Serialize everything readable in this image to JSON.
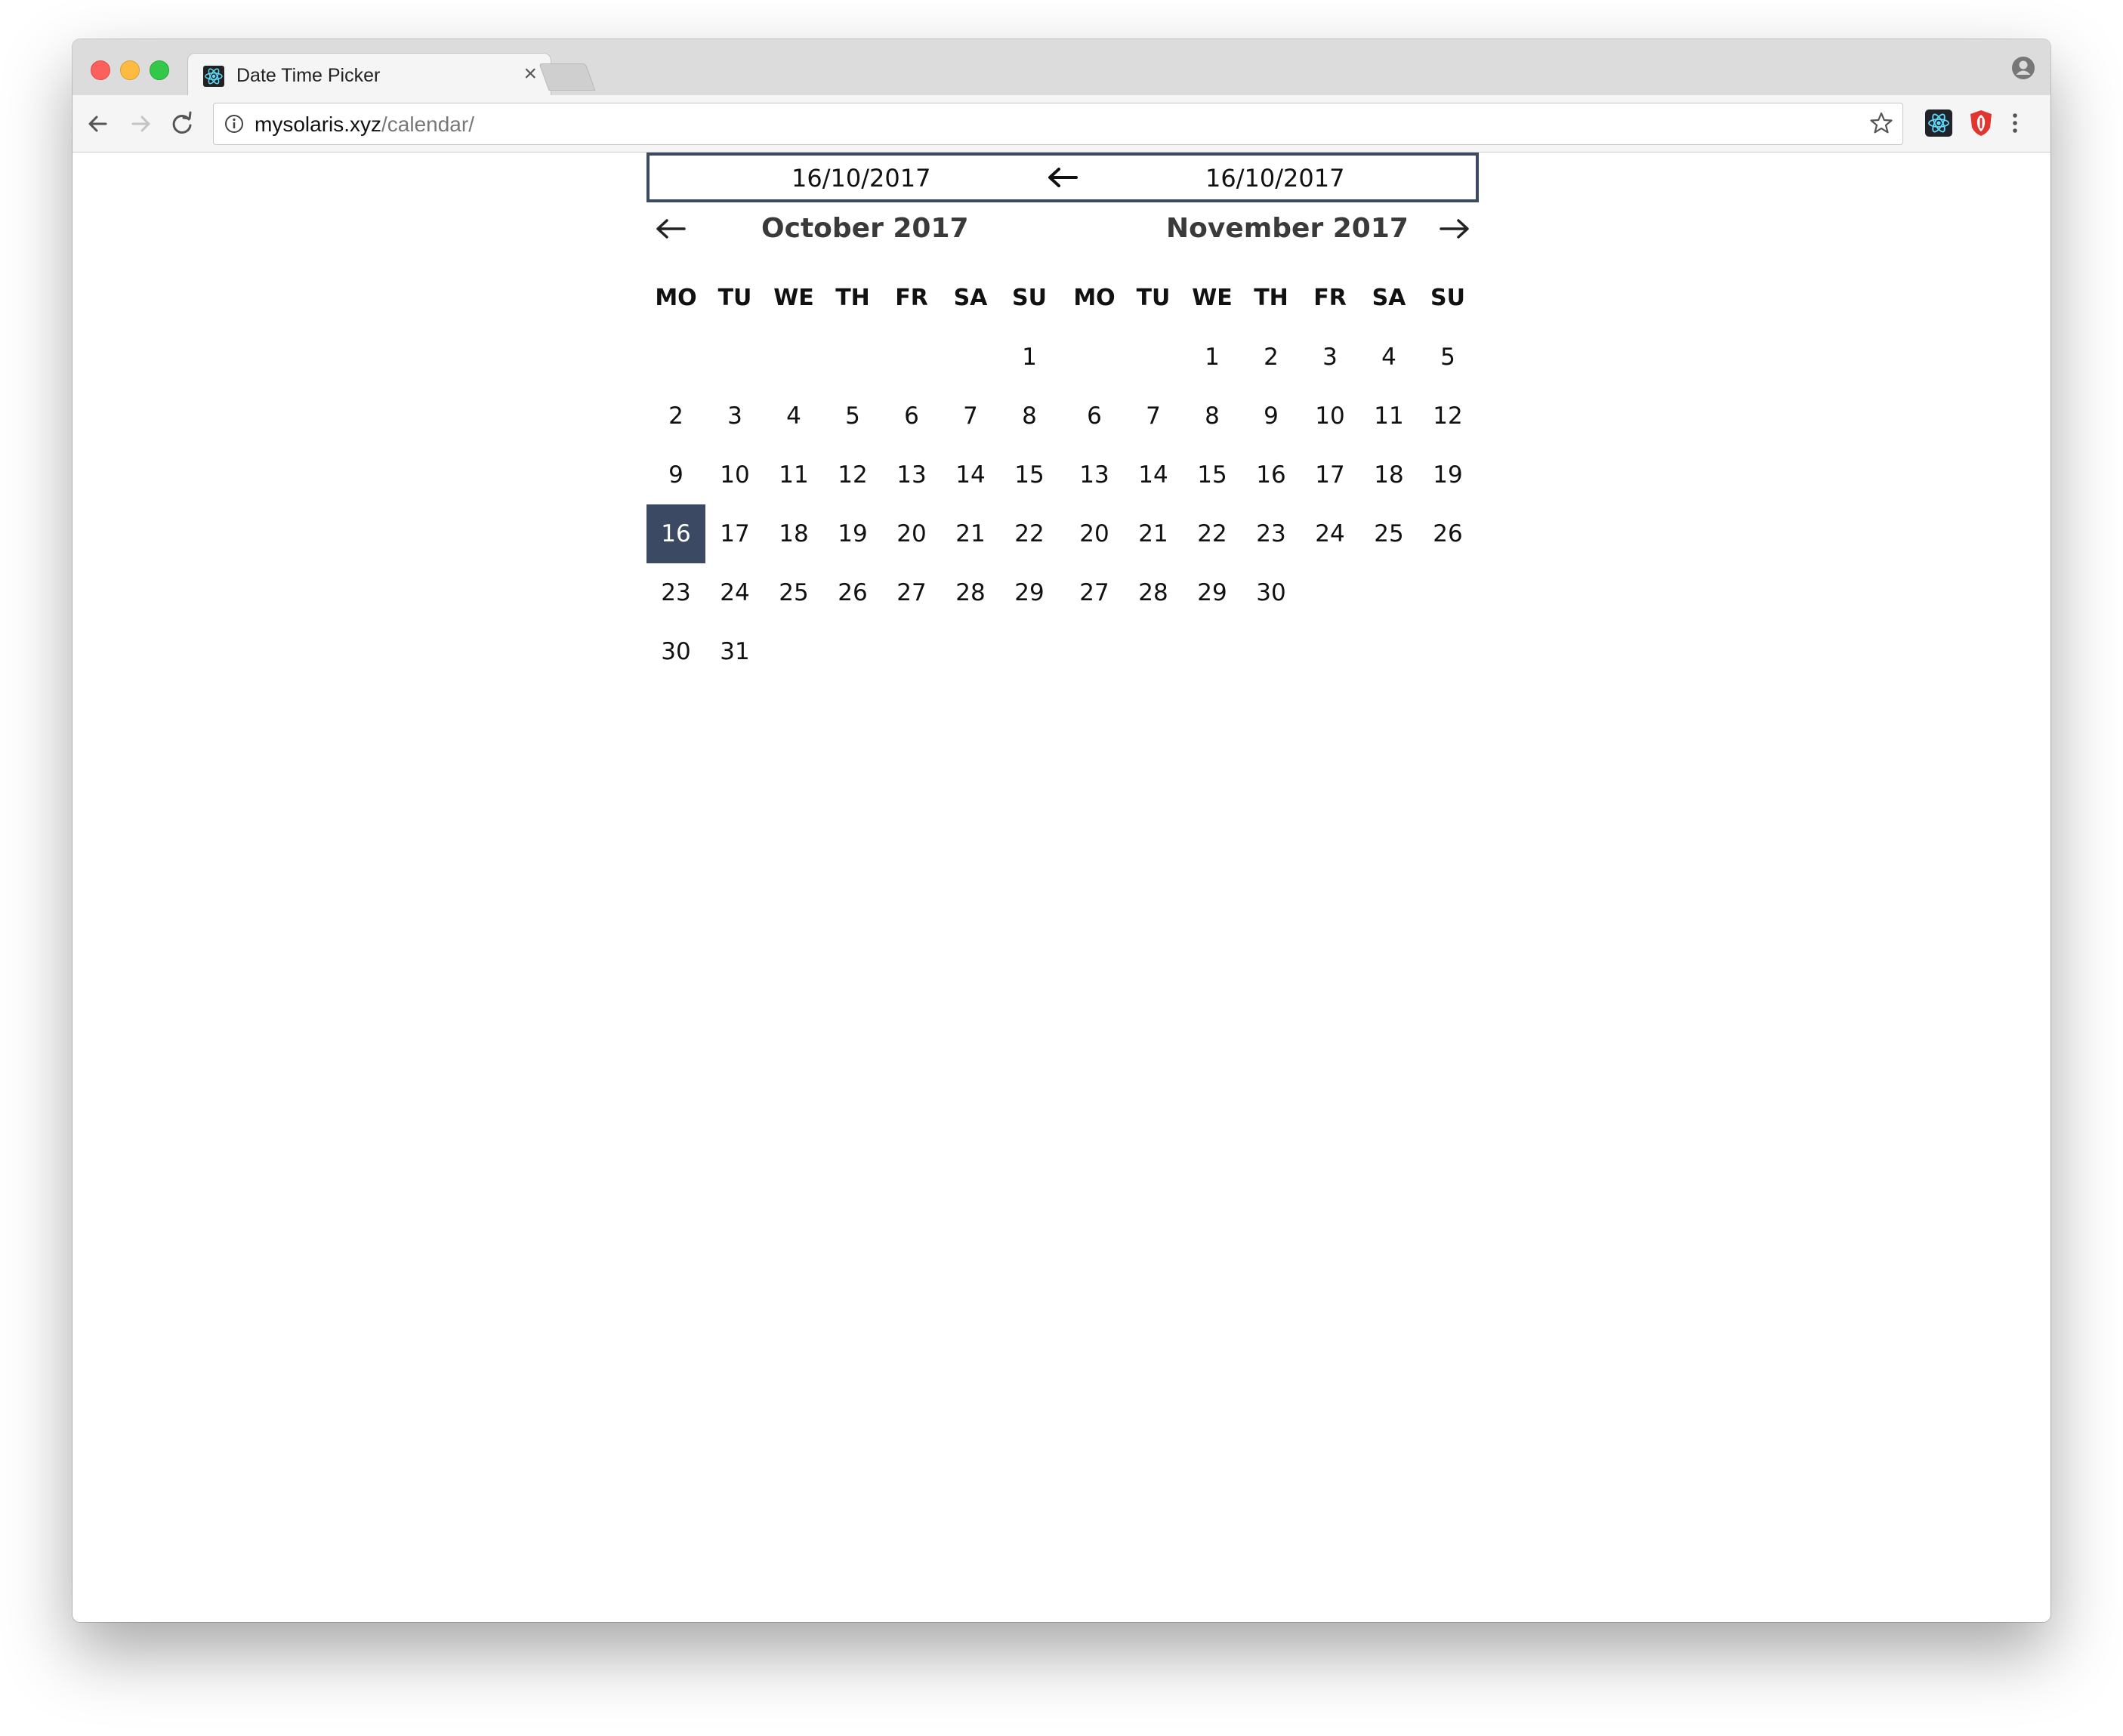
{
  "browser": {
    "tab_title": "Date Time Picker",
    "tab_close": "×",
    "url_host": "mysolaris.xyz",
    "url_path": "/calendar/"
  },
  "picker": {
    "start_value": "16/10/2017",
    "end_value": "16/10/2017",
    "selected": {
      "month": "October 2017",
      "day": "16"
    },
    "weekdays": [
      "MO",
      "TU",
      "WE",
      "TH",
      "FR",
      "SA",
      "SU"
    ],
    "months": [
      {
        "title": "October 2017",
        "weeks": [
          [
            "",
            "",
            "",
            "",
            "",
            "",
            "1"
          ],
          [
            "2",
            "3",
            "4",
            "5",
            "6",
            "7",
            "8"
          ],
          [
            "9",
            "10",
            "11",
            "12",
            "13",
            "14",
            "15"
          ],
          [
            "16",
            "17",
            "18",
            "19",
            "20",
            "21",
            "22"
          ],
          [
            "23",
            "24",
            "25",
            "26",
            "27",
            "28",
            "29"
          ],
          [
            "30",
            "31",
            "",
            "",
            "",
            "",
            ""
          ]
        ]
      },
      {
        "title": "November 2017",
        "weeks": [
          [
            "",
            "",
            "1",
            "2",
            "3",
            "4",
            "5"
          ],
          [
            "6",
            "7",
            "8",
            "9",
            "10",
            "11",
            "12"
          ],
          [
            "13",
            "14",
            "15",
            "16",
            "17",
            "18",
            "19"
          ],
          [
            "20",
            "21",
            "22",
            "23",
            "24",
            "25",
            "26"
          ],
          [
            "27",
            "28",
            "29",
            "30",
            "",
            "",
            ""
          ]
        ]
      }
    ]
  },
  "colors": {
    "accent": "#3b4a62",
    "selected_text": "#ffffff"
  },
  "icons": {
    "range_separator": "arrow-left-icon",
    "prev_month": "arrow-left-icon",
    "next_month": "arrow-right-icon"
  }
}
